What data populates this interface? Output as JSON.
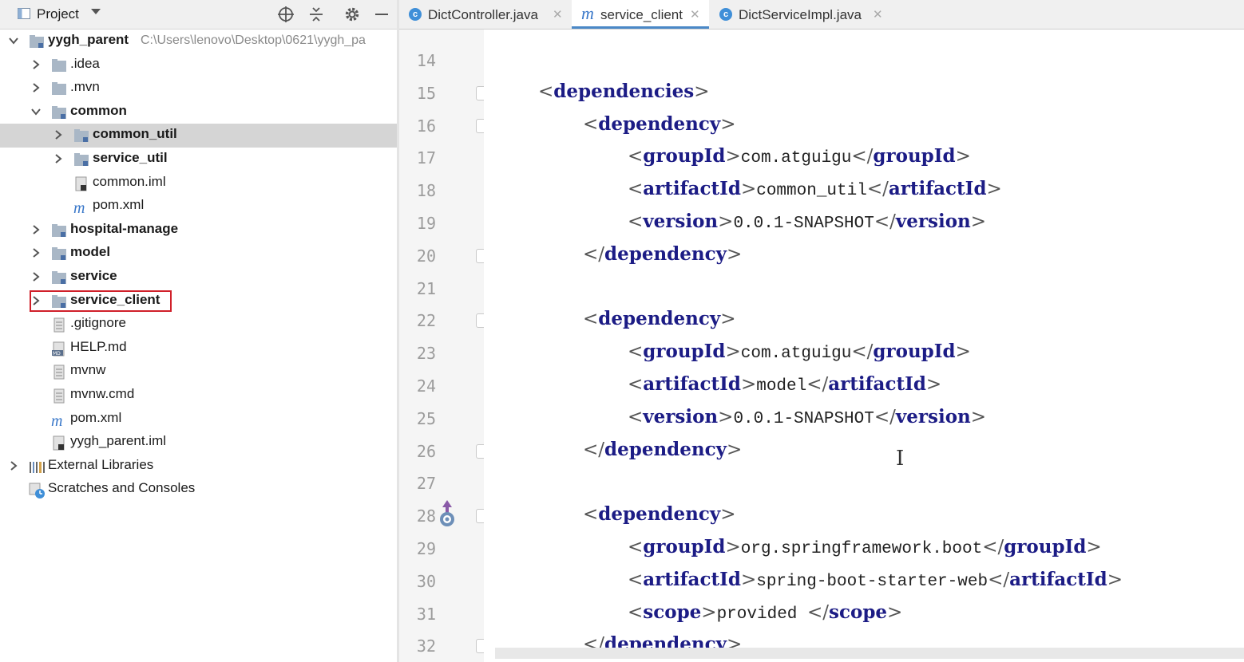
{
  "project_panel": {
    "title": "Project",
    "tree": [
      {
        "label": "yygh_parent",
        "path": "C:\\Users\\lenovo\\Desktop\\0621\\yygh_pa",
        "bold": true,
        "expanded": true,
        "type": "module"
      },
      {
        "label": ".idea",
        "type": "folder"
      },
      {
        "label": ".mvn",
        "type": "folder"
      },
      {
        "label": "common",
        "bold": true,
        "expanded": true,
        "type": "module"
      },
      {
        "label": "common_util",
        "bold": true,
        "type": "module",
        "selected": true
      },
      {
        "label": "service_util",
        "bold": true,
        "type": "module"
      },
      {
        "label": "common.iml",
        "type": "iml"
      },
      {
        "label": "pom.xml",
        "type": "maven"
      },
      {
        "label": "hospital-manage",
        "bold": true,
        "type": "module"
      },
      {
        "label": "model",
        "bold": true,
        "type": "module"
      },
      {
        "label": "service",
        "bold": true,
        "type": "module"
      },
      {
        "label": "service_client",
        "bold": true,
        "type": "module",
        "highlighted": true
      },
      {
        "label": ".gitignore",
        "type": "file"
      },
      {
        "label": "HELP.md",
        "type": "md"
      },
      {
        "label": "mvnw",
        "type": "file"
      },
      {
        "label": "mvnw.cmd",
        "type": "file"
      },
      {
        "label": "pom.xml",
        "type": "maven"
      },
      {
        "label": "yygh_parent.iml",
        "type": "iml"
      },
      {
        "label": "External Libraries",
        "type": "libraries"
      },
      {
        "label": "Scratches and Consoles",
        "type": "scratches"
      }
    ]
  },
  "tabs": [
    {
      "label": "DictController.java",
      "icon": "class-icon",
      "active": false
    },
    {
      "label": "service_client",
      "icon": "maven-icon",
      "active": true
    },
    {
      "label": "DictServiceImpl.java",
      "icon": "class-icon",
      "active": false
    }
  ],
  "editor": {
    "lines": [
      {
        "n": "14",
        "parts": []
      },
      {
        "n": "15",
        "parts": [
          [
            "br",
            "<"
          ],
          [
            "tg",
            "dependencies"
          ],
          [
            "br",
            ">"
          ]
        ],
        "indent": 0
      },
      {
        "n": "16",
        "parts": [
          [
            "br",
            "<"
          ],
          [
            "tg",
            "dependency"
          ],
          [
            "br",
            ">"
          ]
        ],
        "indent": 1
      },
      {
        "n": "17",
        "parts": [
          [
            "br",
            "<"
          ],
          [
            "tg",
            "groupId"
          ],
          [
            "br",
            ">"
          ],
          [
            "tx",
            "com.atguigu"
          ],
          [
            "br",
            "</"
          ],
          [
            "tg",
            "groupId"
          ],
          [
            "br",
            ">"
          ]
        ],
        "indent": 2
      },
      {
        "n": "18",
        "parts": [
          [
            "br",
            "<"
          ],
          [
            "tg",
            "artifactId"
          ],
          [
            "br",
            ">"
          ],
          [
            "tx",
            "common_util"
          ],
          [
            "br",
            "</"
          ],
          [
            "tg",
            "artifactId"
          ],
          [
            "br",
            ">"
          ]
        ],
        "indent": 2
      },
      {
        "n": "19",
        "parts": [
          [
            "br",
            "<"
          ],
          [
            "tg",
            "version"
          ],
          [
            "br",
            ">"
          ],
          [
            "tx",
            "0.0.1-SNAPSHOT"
          ],
          [
            "br",
            "</"
          ],
          [
            "tg",
            "version"
          ],
          [
            "br",
            ">"
          ]
        ],
        "indent": 2
      },
      {
        "n": "20",
        "parts": [
          [
            "br",
            "</"
          ],
          [
            "tg",
            "dependency"
          ],
          [
            "br",
            ">"
          ]
        ],
        "indent": 1
      },
      {
        "n": "21",
        "parts": []
      },
      {
        "n": "22",
        "parts": [
          [
            "br",
            "<"
          ],
          [
            "tg",
            "dependency"
          ],
          [
            "br",
            ">"
          ]
        ],
        "indent": 1
      },
      {
        "n": "23",
        "parts": [
          [
            "br",
            "<"
          ],
          [
            "tg",
            "groupId"
          ],
          [
            "br",
            ">"
          ],
          [
            "tx",
            "com.atguigu"
          ],
          [
            "br",
            "</"
          ],
          [
            "tg",
            "groupId"
          ],
          [
            "br",
            ">"
          ]
        ],
        "indent": 2
      },
      {
        "n": "24",
        "parts": [
          [
            "br",
            "<"
          ],
          [
            "tg",
            "artifactId"
          ],
          [
            "br",
            ">"
          ],
          [
            "tx",
            "model"
          ],
          [
            "br",
            "</"
          ],
          [
            "tg",
            "artifactId"
          ],
          [
            "br",
            ">"
          ]
        ],
        "indent": 2
      },
      {
        "n": "25",
        "parts": [
          [
            "br",
            "<"
          ],
          [
            "tg",
            "version"
          ],
          [
            "br",
            ">"
          ],
          [
            "tx",
            "0.0.1-SNAPSHOT"
          ],
          [
            "br",
            "</"
          ],
          [
            "tg",
            "version"
          ],
          [
            "br",
            ">"
          ]
        ],
        "indent": 2
      },
      {
        "n": "26",
        "parts": [
          [
            "br",
            "</"
          ],
          [
            "tg",
            "dependency"
          ],
          [
            "br",
            ">"
          ]
        ],
        "indent": 1
      },
      {
        "n": "27",
        "parts": []
      },
      {
        "n": "28",
        "parts": [
          [
            "br",
            "<"
          ],
          [
            "tg",
            "dependency"
          ],
          [
            "br",
            ">"
          ]
        ],
        "indent": 1
      },
      {
        "n": "29",
        "parts": [
          [
            "br",
            "<"
          ],
          [
            "tg",
            "groupId"
          ],
          [
            "br",
            ">"
          ],
          [
            "tx",
            "org.springframework.boot"
          ],
          [
            "br",
            "</"
          ],
          [
            "tg",
            "groupId"
          ],
          [
            "br",
            ">"
          ]
        ],
        "indent": 2
      },
      {
        "n": "30",
        "parts": [
          [
            "br",
            "<"
          ],
          [
            "tg",
            "artifactId"
          ],
          [
            "br",
            ">"
          ],
          [
            "tx",
            "spring-boot-starter-web"
          ],
          [
            "br",
            "</"
          ],
          [
            "tg",
            "artifactId"
          ],
          [
            "br",
            ">"
          ]
        ],
        "indent": 2
      },
      {
        "n": "31",
        "parts": [
          [
            "br",
            "<"
          ],
          [
            "tg",
            "scope"
          ],
          [
            "br",
            ">"
          ],
          [
            "tx",
            "provided "
          ],
          [
            "br",
            "</"
          ],
          [
            "tg",
            "scope"
          ],
          [
            "br",
            ">"
          ]
        ],
        "indent": 2
      },
      {
        "n": "32",
        "parts": [
          [
            "br",
            "</"
          ],
          [
            "tg",
            "dependency"
          ],
          [
            "br",
            ">"
          ]
        ],
        "indent": 1
      }
    ],
    "fold_lines": [
      "15",
      "16",
      "20",
      "22",
      "26",
      "28",
      "32"
    ]
  },
  "colors": {
    "tag": "#1c1c85",
    "highlight_border": "#d0202a",
    "tab_underline": "#4a88c7"
  }
}
